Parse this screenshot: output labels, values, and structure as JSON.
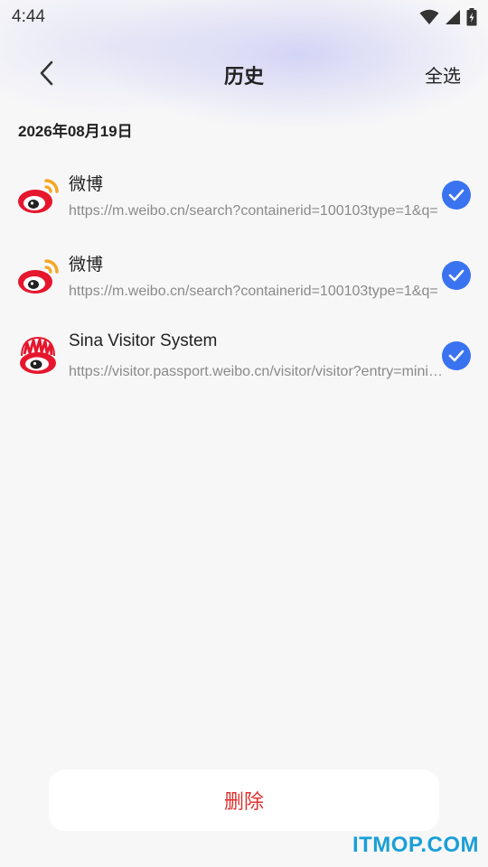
{
  "status_bar": {
    "time": "4:44",
    "icons": [
      "wifi-icon",
      "signal-icon",
      "battery-charging-icon"
    ]
  },
  "header": {
    "back_icon": "chevron-left-icon",
    "title": "历史",
    "select_all_label": "全选"
  },
  "history": {
    "date": "2026年08月19日",
    "items": [
      {
        "icon": "weibo-logo-icon",
        "title": "微博",
        "url": "https://m.weibo.cn/search?containerid=100103type=1&q=",
        "checked": true
      },
      {
        "icon": "weibo-logo-icon",
        "title": "微博",
        "url": "https://m.weibo.cn/search?containerid=100103type=1&q=",
        "checked": true
      },
      {
        "icon": "sina-logo-icon",
        "title": "Sina Visitor System",
        "url": "https://visitor.passport.weibo.cn/visitor/visitor?entry=miniblog",
        "checked": true
      }
    ]
  },
  "footer": {
    "delete_label": "删除"
  },
  "watermark": "ITMOP.COM",
  "colors": {
    "accent_blue": "#3a73f0",
    "delete_red": "#e0302f",
    "watermark_blue": "#1b9fd6"
  }
}
